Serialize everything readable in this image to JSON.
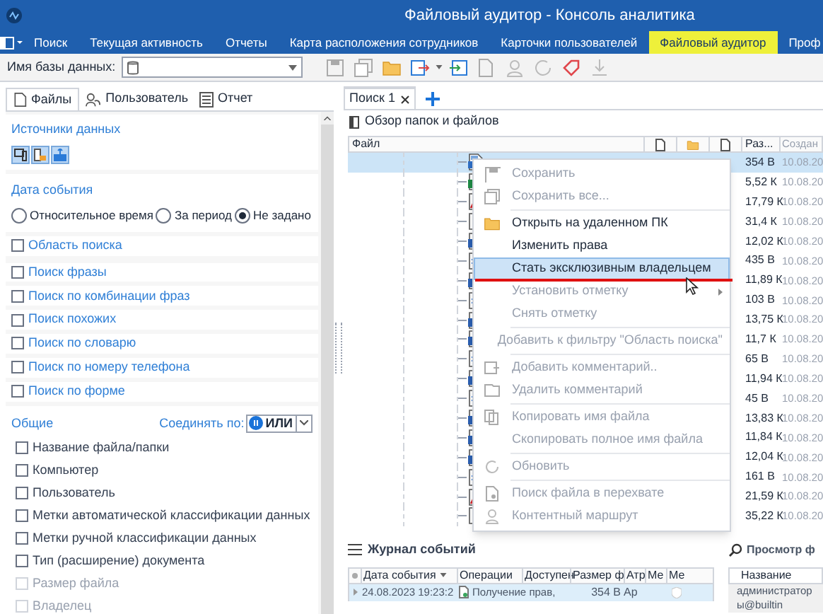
{
  "window": {
    "title": "Файловый аудитор - Консоль аналитика"
  },
  "ribbon_tabs": [
    {
      "label": "Поиск",
      "selected": false
    },
    {
      "label": "Текущая активность",
      "selected": false
    },
    {
      "label": "Отчеты",
      "selected": false
    },
    {
      "label": "Карта расположения сотрудников",
      "selected": false
    },
    {
      "label": "Карточки пользователей",
      "selected": false
    },
    {
      "label": "Файловый аудитор",
      "selected": true
    },
    {
      "label": "Проф",
      "selected": false
    }
  ],
  "toolbar": {
    "database_label": "Имя базы данных:"
  },
  "left_panel": {
    "tabs": [
      {
        "label": "Файлы",
        "selected": true
      },
      {
        "label": "Пользователь",
        "selected": false
      },
      {
        "label": "Отчет",
        "selected": false
      }
    ],
    "data_sources": {
      "title": "Источники данных"
    },
    "event_date": {
      "title": "Дата события",
      "options": [
        {
          "label": "Относительное время",
          "selected": false
        },
        {
          "label": "За период",
          "selected": false
        },
        {
          "label": "Не задано",
          "selected": true
        }
      ]
    },
    "filters": [
      {
        "label": "Область поиска",
        "checked": false
      },
      {
        "label": "Поиск фразы",
        "checked": false
      },
      {
        "label": "Поиск по комбинации фраз",
        "checked": false
      },
      {
        "label": "Поиск похожих",
        "checked": false
      },
      {
        "label": "Поиск по словарю",
        "checked": false
      },
      {
        "label": "Поиск по номеру телефона",
        "checked": false
      },
      {
        "label": "Поиск по форме",
        "checked": false
      }
    ],
    "general": {
      "title": "Общие",
      "join_label": "Соединять по:",
      "join_value": "ИЛИ",
      "items": [
        {
          "label": "Название файла/папки",
          "checked": false,
          "disabled": false
        },
        {
          "label": "Компьютер",
          "checked": false,
          "disabled": false
        },
        {
          "label": "Пользователь",
          "checked": false,
          "disabled": false
        },
        {
          "label": "Метки автоматической классификации данных",
          "checked": false,
          "disabled": false
        },
        {
          "label": "Метки ручной классификации данных",
          "checked": false,
          "disabled": false
        },
        {
          "label": "Тип (расширение) документа",
          "checked": false,
          "disabled": false
        },
        {
          "label": "Размер файла",
          "checked": false,
          "disabled": true
        },
        {
          "label": "Владелец",
          "checked": false,
          "disabled": true
        }
      ]
    }
  },
  "search_tabs": [
    {
      "label": "Поиск 1",
      "selected": true
    }
  ],
  "browser": {
    "title": "Обзор папок и файлов",
    "columns": {
      "file": "Файл",
      "size": "Раз...",
      "created": "Создан"
    },
    "rows": [
      {
        "kind": "csv",
        "size": "354 B",
        "created": "10.08.20",
        "selected": true
      },
      {
        "kind": "sheet",
        "size": "5,52 К",
        "created": "10.08.20",
        "selected": false
      },
      {
        "kind": "pdf",
        "size": "17,79 К",
        "created": "10.08.20",
        "selected": false
      },
      {
        "kind": "blank",
        "size": "31,4 К",
        "created": "10.08.20",
        "selected": false
      },
      {
        "kind": "word",
        "size": "12,02 К",
        "created": "10.08.20",
        "selected": false
      },
      {
        "kind": "text",
        "size": "435 B",
        "created": "10.08.20",
        "selected": false
      },
      {
        "kind": "word",
        "size": "11,89 К",
        "created": "10.08.20",
        "selected": false
      },
      {
        "kind": "text",
        "size": "103 B",
        "created": "10.08.20",
        "selected": false
      },
      {
        "kind": "word",
        "size": "13,75 К",
        "created": "10.08.20",
        "selected": false
      },
      {
        "kind": "word",
        "size": "11,7 К",
        "created": "10.08.20",
        "selected": false
      },
      {
        "kind": "text",
        "size": "65 B",
        "created": "10.08.20",
        "selected": false
      },
      {
        "kind": "word",
        "size": "11,94 К",
        "created": "10.08.20",
        "selected": false
      },
      {
        "kind": "text",
        "size": "45 B",
        "created": "10.08.20",
        "selected": false
      },
      {
        "kind": "word",
        "size": "13,83 К",
        "created": "10.08.20",
        "selected": false
      },
      {
        "kind": "word",
        "size": "11,84 К",
        "created": "10.08.20",
        "selected": false
      },
      {
        "kind": "word",
        "size": "12,04 К",
        "created": "10.08.20",
        "selected": false
      },
      {
        "kind": "text",
        "size": "161 B",
        "created": "10.08.20",
        "selected": false
      },
      {
        "kind": "pdf",
        "size": "21,59 К",
        "created": "10.08.20",
        "selected": false
      },
      {
        "kind": "blank",
        "size": "35,22 К",
        "created": "10.08.20",
        "selected": false
      }
    ]
  },
  "context_menu": [
    {
      "kind": "item",
      "label": "Сохранить",
      "disabled": true,
      "selected": false
    },
    {
      "kind": "item",
      "label": "Сохранить все...",
      "disabled": true,
      "selected": false
    },
    {
      "kind": "separator"
    },
    {
      "kind": "item",
      "label": "Открыть на удаленном ПК",
      "disabled": false,
      "selected": false
    },
    {
      "kind": "item",
      "label": "Изменить права",
      "disabled": false,
      "selected": false
    },
    {
      "kind": "item",
      "label": "Стать эксклюзивным владельцем",
      "disabled": false,
      "selected": true
    },
    {
      "kind": "submenu",
      "label": "Установить отметку",
      "disabled": true,
      "selected": false
    },
    {
      "kind": "item",
      "label": "Снять отметку",
      "disabled": true,
      "selected": false
    },
    {
      "kind": "separator"
    },
    {
      "kind": "item",
      "label": "Добавить к фильтру \"Область поиска\"",
      "disabled": true,
      "selected": false
    },
    {
      "kind": "separator"
    },
    {
      "kind": "item",
      "label": "Добавить комментарий..",
      "disabled": true,
      "selected": false
    },
    {
      "kind": "item",
      "label": "Удалить комментарий",
      "disabled": true,
      "selected": false
    },
    {
      "kind": "separator"
    },
    {
      "kind": "item",
      "label": "Копировать имя файла",
      "disabled": true,
      "selected": false
    },
    {
      "kind": "item",
      "label": "Скопировать полное имя файла",
      "disabled": true,
      "selected": false
    },
    {
      "kind": "separator"
    },
    {
      "kind": "item",
      "label": "Обновить",
      "disabled": true,
      "selected": false
    },
    {
      "kind": "separator"
    },
    {
      "kind": "item",
      "label": "Поиск файла в перехвате",
      "disabled": true,
      "selected": false
    },
    {
      "kind": "item",
      "label": "Контентный маршрут",
      "disabled": true,
      "selected": false
    }
  ],
  "event_log": {
    "title": "Журнал событий",
    "columns": [
      "Дата события",
      "Операции",
      "Доступен",
      "Размер ф",
      "Атр",
      "Ме",
      "Ме"
    ],
    "rows": [
      {
        "date": "24.08.2023 19:23:2",
        "operation": "Получение прав,",
        "size": "354 B",
        "attributes": "Ap"
      }
    ]
  },
  "preview": {
    "title": "Просмотр ф",
    "columns": [
      "Название"
    ],
    "rows": [
      {
        "lines": [
          "администратор",
          "ы@builtin"
        ]
      }
    ]
  }
}
